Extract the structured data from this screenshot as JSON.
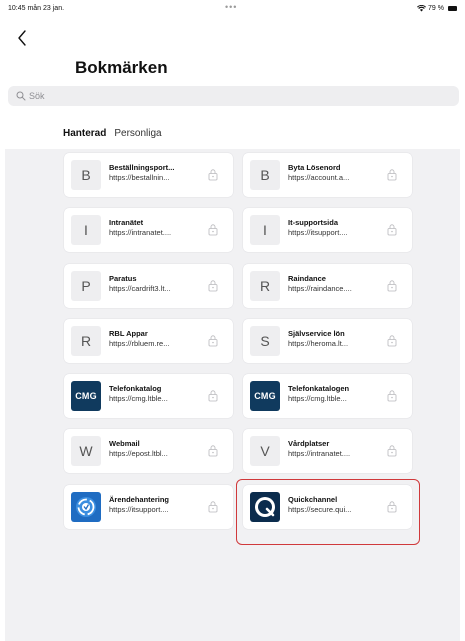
{
  "status_bar": {
    "time": "10:45  mån 23 jan.",
    "dots": "•••",
    "battery_text": "79 %"
  },
  "page": {
    "title": "Bokmärken"
  },
  "search": {
    "placeholder": "Sök"
  },
  "tabs": [
    {
      "label": "Hanterad",
      "active": true
    },
    {
      "label": "Personliga",
      "active": false
    }
  ],
  "bookmarks": [
    {
      "title": "Beställningsport...",
      "url": "https://bestallnin...",
      "icon_letter": "B",
      "icon_kind": "letter"
    },
    {
      "title": "Byta Lösenord",
      "url": "https://account.a...",
      "icon_letter": "B",
      "icon_kind": "letter"
    },
    {
      "title": "Intranätet",
      "url": "https://intranatet....",
      "icon_letter": "I",
      "icon_kind": "letter"
    },
    {
      "title": "It-supportsida",
      "url": "https://itsupport....",
      "icon_letter": "I",
      "icon_kind": "letter"
    },
    {
      "title": "Paratus",
      "url": "https://cardrift3.lt...",
      "icon_letter": "P",
      "icon_kind": "letter"
    },
    {
      "title": "Raindance",
      "url": "https://raindance....",
      "icon_letter": "R",
      "icon_kind": "letter"
    },
    {
      "title": "RBL Appar",
      "url": "https://rbluem.re...",
      "icon_letter": "R",
      "icon_kind": "letter"
    },
    {
      "title": "Självservice lön",
      "url": "https://heroma.lt...",
      "icon_letter": "S",
      "icon_kind": "letter"
    },
    {
      "title": "Telefonkatalog",
      "url": "https://cmg.ltble...",
      "icon_letter": "CMG",
      "icon_kind": "cmg-logo"
    },
    {
      "title": "Telefonkatalogen",
      "url": "https://cmg.ltble...",
      "icon_letter": "CMG",
      "icon_kind": "cmg-logo"
    },
    {
      "title": "Webmail",
      "url": "https://epost.ltbl...",
      "icon_letter": "W",
      "icon_kind": "letter"
    },
    {
      "title": "Vårdplatser",
      "url": "https://intranatet....",
      "icon_letter": "V",
      "icon_kind": "letter"
    },
    {
      "title": "Ärendehantering",
      "url": "https://itsupport....",
      "icon_letter": "",
      "icon_kind": "support-logo"
    },
    {
      "title": "Quickchannel",
      "url": "https://secure.qui...",
      "icon_letter": "",
      "icon_kind": "quickchannel-logo"
    }
  ],
  "colors": {
    "content_bg": "#f1f1f3",
    "highlight": "#d0393b",
    "cmg_blue": "#103a5e"
  }
}
